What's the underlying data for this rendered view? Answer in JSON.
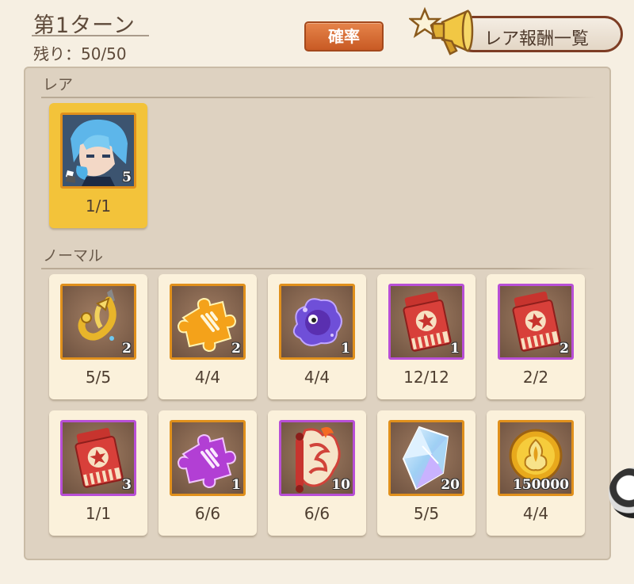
{
  "header": {
    "turn_title": "第1ターン",
    "remaining": "残り：50/50",
    "probability_button": "確率",
    "rare_rewards_button": "レア報酬一覧"
  },
  "sections": {
    "rare_label": "レア",
    "normal_label": "ノーマル"
  },
  "rare_items": [
    {
      "icon": "character-portrait-icon",
      "qty": "5",
      "count": "1/1",
      "frame": "orange"
    }
  ],
  "normal_items": [
    {
      "icon": "golden-hook-icon",
      "qty": "2",
      "count": "5/5",
      "frame": "orange"
    },
    {
      "icon": "orange-puzzle-piece-icon",
      "qty": "2",
      "count": "4/4",
      "frame": "orange"
    },
    {
      "icon": "purple-slime-icon",
      "qty": "1",
      "count": "4/4",
      "frame": "orange"
    },
    {
      "icon": "red-ticket-icon",
      "qty": "1",
      "count": "12/12",
      "frame": "purple"
    },
    {
      "icon": "red-ticket-icon",
      "qty": "2",
      "count": "2/2",
      "frame": "purple"
    },
    {
      "icon": "red-ticket-icon",
      "qty": "3",
      "count": "1/1",
      "frame": "purple"
    },
    {
      "icon": "purple-puzzle-piece-icon",
      "qty": "1",
      "count": "6/6",
      "frame": "orange"
    },
    {
      "icon": "fire-scroll-icon",
      "qty": "10",
      "count": "6/6",
      "frame": "purple"
    },
    {
      "icon": "crystal-icon",
      "qty": "20",
      "count": "5/5",
      "frame": "orange"
    },
    {
      "icon": "gold-coin-icon",
      "qty": "150000",
      "count": "4/4",
      "frame": "orange"
    }
  ],
  "colors": {
    "background": "#f6efe2",
    "panel": "#ded2c1",
    "card": "#fbf1db",
    "rare_card": "#f3c33a",
    "orange_frame": "#e0901c",
    "purple_frame": "#b84fd6",
    "probability_button": "#d86a30",
    "rare_button_border": "#7d3d24"
  }
}
